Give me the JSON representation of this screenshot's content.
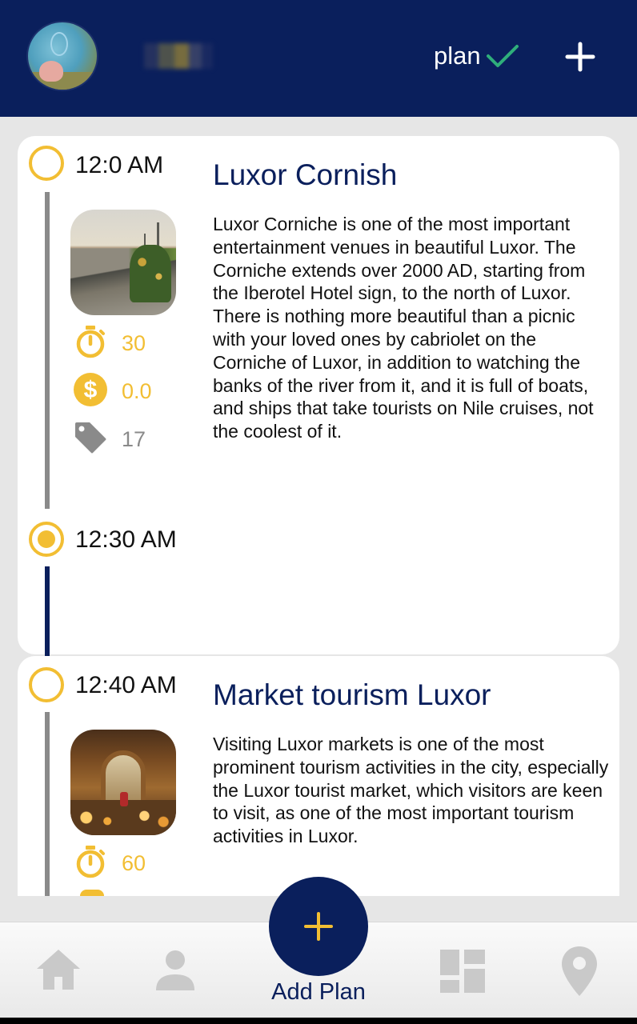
{
  "header": {
    "plan_label": "plan"
  },
  "timeline": [
    {
      "time": "12:0 AM",
      "title": "Luxor Cornish",
      "description": "Luxor Corniche is one of the most important entertainment venues in beautiful Luxor. The Corniche extends over 2000 AD, starting from the Iberotel Hotel sign, to the north of Luxor. There is nothing more beautiful than a picnic with your loved ones by cabriolet on the Corniche of Luxor, in addition to watching the banks of the river from it, and it is full of boats, and ships that take tourists on Nile cruises, not the coolest of it.",
      "duration": "30",
      "cost": "0.0",
      "tag": "17"
    },
    {
      "time": "12:30 AM"
    },
    {
      "time": "12:40 AM",
      "title": "Market tourism Luxor",
      "description": "Visiting Luxor markets is one of the most prominent tourism activities in the city, especially the Luxor tourist market, which visitors are keen to visit, as one of the most important tourism activities in Luxor.",
      "duration": "60"
    }
  ],
  "bottom_nav": {
    "add_plan_label": "Add Plan",
    "items": [
      "home-icon",
      "profile-icon",
      "add-plan-button",
      "dashboard-icon",
      "location-pin-icon"
    ]
  },
  "colors": {
    "navy": "#0a1f5c",
    "gold": "#f2be33",
    "check_green": "#2fae7b",
    "gray": "#8a8a8a",
    "nav_gray": "#c9c9c9"
  }
}
